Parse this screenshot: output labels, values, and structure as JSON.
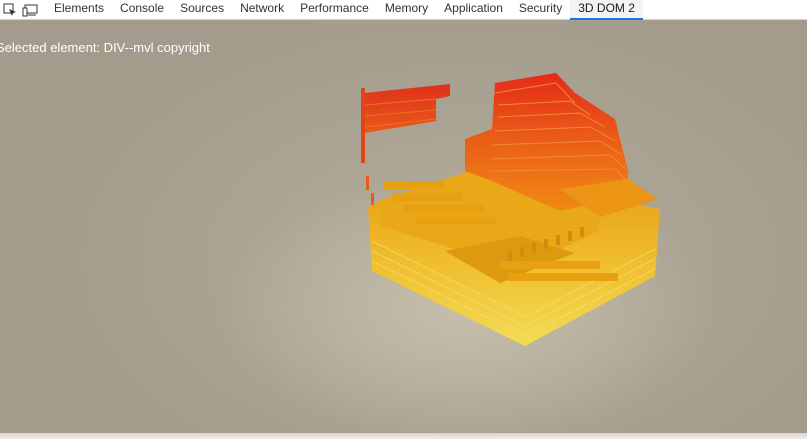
{
  "toolbar": {
    "inspect_icon": "inspect-element-icon",
    "device_icon": "device-toolbar-icon",
    "tabs": [
      {
        "label": "Elements"
      },
      {
        "label": "Console"
      },
      {
        "label": "Sources"
      },
      {
        "label": "Network"
      },
      {
        "label": "Performance"
      },
      {
        "label": "Memory"
      },
      {
        "label": "Application"
      },
      {
        "label": "Security"
      },
      {
        "label": "3D DOM 2",
        "active": true
      }
    ]
  },
  "viewport": {
    "selected_element_text": "Selected element: DIV--mvl copyright"
  },
  "colors": {
    "layer_top": "#e0301a",
    "layer_mid": "#f09010",
    "layer_base": "#f0d040",
    "accent": "#1a73e8"
  }
}
